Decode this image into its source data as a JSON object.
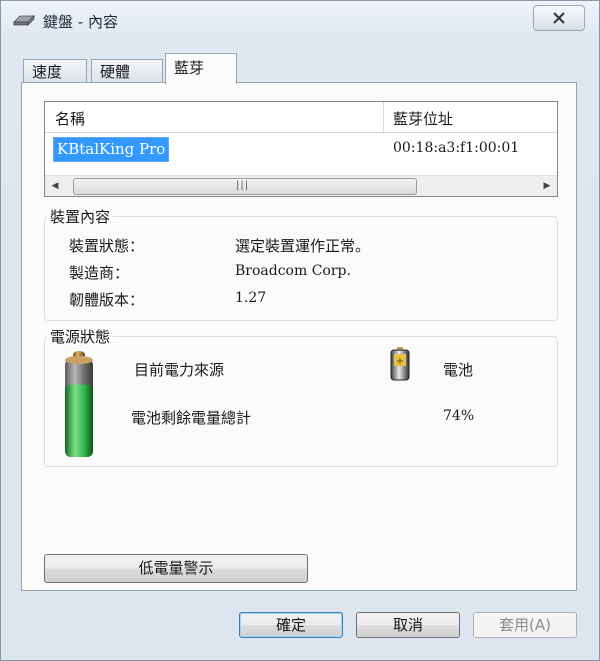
{
  "window": {
    "title": "鍵盤 - 內容"
  },
  "tabs": [
    {
      "label": "速度"
    },
    {
      "label": "硬體"
    },
    {
      "label": "藍芽",
      "active": true
    }
  ],
  "device_list": {
    "columns": [
      "名稱",
      "藍芽位址"
    ],
    "rows": [
      {
        "name": "KBtalKing Pro",
        "address": "00:18:a3:f1:00:01",
        "selected": true
      }
    ]
  },
  "device_info": {
    "title": "裝置內容",
    "status_label": "裝置狀態：",
    "status_value": "選定裝置運作正常。",
    "manufacturer_label": "製造商：",
    "manufacturer_value": "Broadcom Corp.",
    "firmware_label": "韌體版本：",
    "firmware_value": "1.27"
  },
  "power": {
    "title": "電源狀態",
    "source_label": "目前電力來源",
    "source_value": "電池",
    "remaining_label": "電池剩餘電量總計",
    "remaining_value": "74%",
    "battery_level": 0.74
  },
  "buttons": {
    "low_battery_alert": "低電量警示",
    "ok": "確定",
    "cancel": "取消",
    "apply": "套用(A)"
  },
  "colors": {
    "selection": "#3399ff",
    "battery_green": "#2fb44a"
  }
}
